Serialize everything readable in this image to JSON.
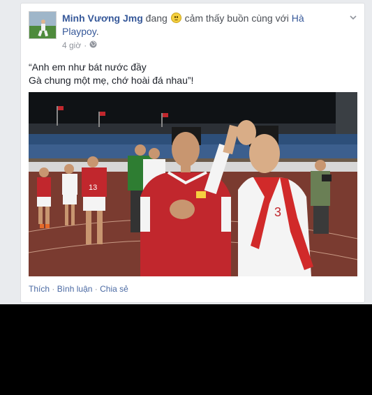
{
  "post": {
    "author": "Minh Vương Jmg",
    "feeling_prefix": "đang",
    "feeling_text": "cảm thấy buồn cùng với",
    "tagged": "Hà Playpoy",
    "tagged_suffix": ".",
    "time": "4 giờ",
    "separator": "·",
    "text_line1": "“Anh em như bát nước đầy",
    "text_line2": "Gà chung một mẹ, chớ hoài đá nhau”!",
    "photo_icon": "football-team-photo",
    "mood_icon": "sad-face-icon",
    "privacy_icon": "globe-icon"
  },
  "actions": {
    "like": "Thích",
    "comment": "Bình luận",
    "share": "Chia sẻ",
    "sep": "·"
  },
  "colors": {
    "link": "#365899",
    "meta": "#90949c",
    "jersey_red": "#c1272d"
  }
}
